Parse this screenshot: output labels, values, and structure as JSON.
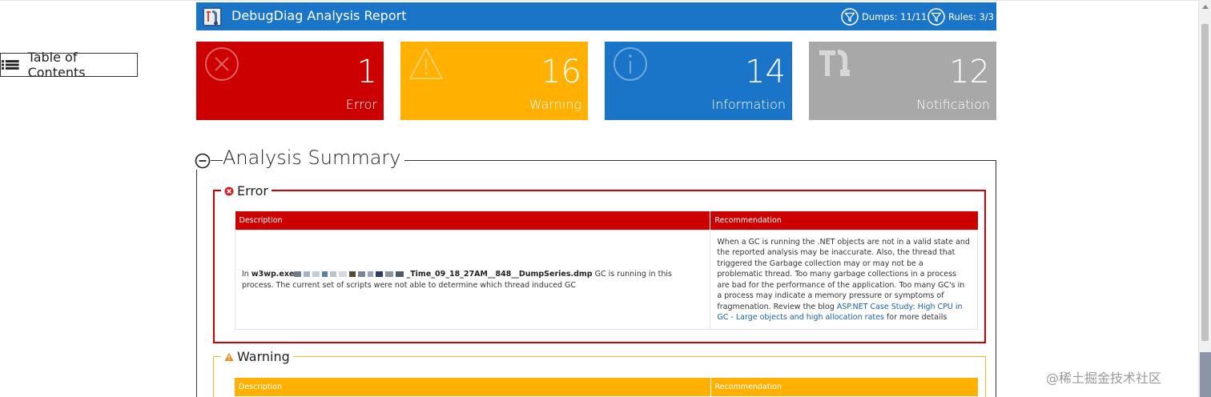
{
  "header": {
    "title": "DebugDiag Analysis Report",
    "dumps": "Dumps: 11/11",
    "rules": "Rules: 3/3",
    "background_color": "#1a75c8"
  },
  "toc": {
    "label": "Table of Contents"
  },
  "tiles": [
    {
      "count": "1",
      "label": "Error",
      "color": "#cc0000",
      "icon": "circle-x-icon"
    },
    {
      "count": "16",
      "label": "Warning",
      "color": "#ffb000",
      "icon": "warning-triangle-icon"
    },
    {
      "count": "14",
      "label": "Information",
      "color": "#1a75c8",
      "icon": "info-circle-icon"
    },
    {
      "count": "12",
      "label": "Notification",
      "color": "#a8a8a8",
      "icon": "tools-icon"
    }
  ],
  "summary": {
    "title": "Analysis Summary"
  },
  "error_section": {
    "legend": "Error",
    "headers": {
      "description": "Description",
      "recommendation": "Recommendation"
    },
    "row": {
      "desc_prefix": "In ",
      "desc_file_start": "w3wp.exe",
      "desc_file_end": "_Time_09_18_27AM__848__DumpSeries.dmp",
      "desc_suffix": " GC is running in this process. The current set of scripts were not able to determine which thread induced GC",
      "rec_text": "When a GC is running the .NET objects are not in a valid state and the reported analysis may be inaccurate. Also, the thread that triggered the Garbage collection may or may not be a problematic thread. Too many garbage collections in a process are bad for the performance of the application. Too many GC's in a process may indicate a memory pressure or symptoms of fragmenation. Review the blog ",
      "rec_link": "ASP.NET Case Study: High CPU in GC - Large objects and high allocation rates",
      "rec_after": " for more details"
    }
  },
  "warning_section": {
    "legend": "Warning",
    "headers": {
      "description": "Description",
      "recommendation": "Recommendation"
    }
  },
  "watermark": "@稀土掘金技术社区"
}
